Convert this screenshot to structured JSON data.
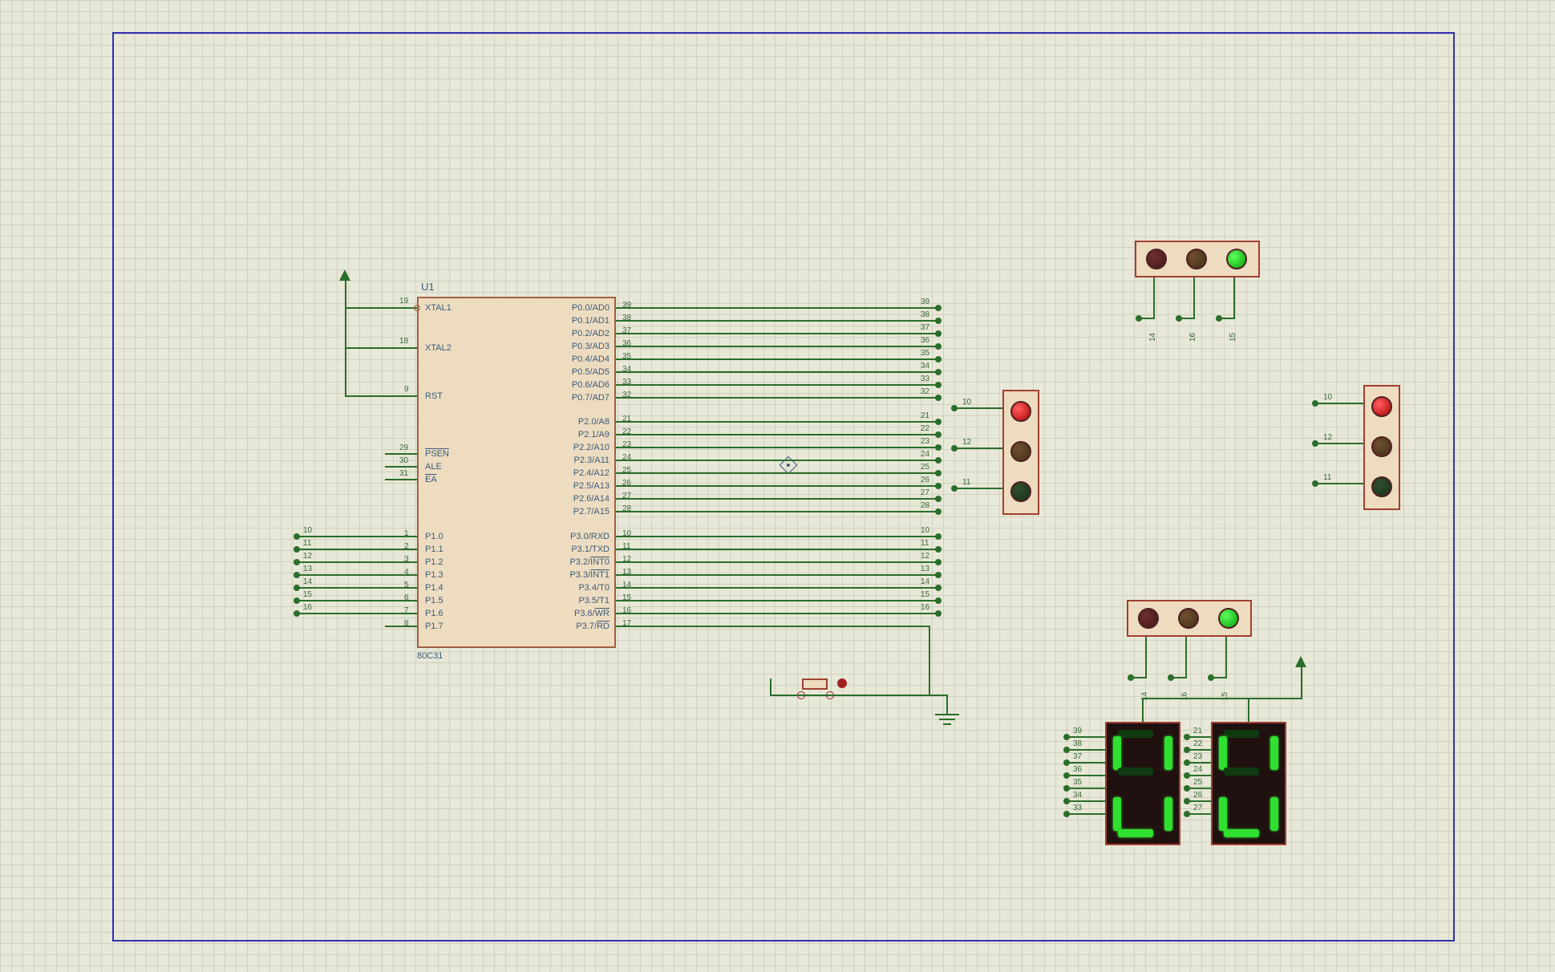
{
  "component": {
    "refdes": "U1",
    "part": "80C31",
    "left_pins": [
      {
        "num": "19",
        "name": "XTAL1"
      },
      {
        "num": "18",
        "name": "XTAL2"
      },
      {
        "num": "9",
        "name": "RST"
      },
      {
        "num": "29",
        "name": "PSEN",
        "over": true
      },
      {
        "num": "30",
        "name": "ALE"
      },
      {
        "num": "31",
        "name": "EA",
        "over": true
      },
      {
        "num": "1",
        "name": "P1.0"
      },
      {
        "num": "2",
        "name": "P1.1"
      },
      {
        "num": "3",
        "name": "P1.2"
      },
      {
        "num": "4",
        "name": "P1.3"
      },
      {
        "num": "5",
        "name": "P1.4"
      },
      {
        "num": "6",
        "name": "P1.5"
      },
      {
        "num": "7",
        "name": "P1.6"
      },
      {
        "num": "8",
        "name": "P1.7"
      }
    ],
    "right_pins": [
      {
        "num": "39",
        "name": "P0.0/AD0"
      },
      {
        "num": "38",
        "name": "P0.1/AD1"
      },
      {
        "num": "37",
        "name": "P0.2/AD2"
      },
      {
        "num": "36",
        "name": "P0.3/AD3"
      },
      {
        "num": "35",
        "name": "P0.4/AD4"
      },
      {
        "num": "34",
        "name": "P0.5/AD5"
      },
      {
        "num": "33",
        "name": "P0.6/AD6"
      },
      {
        "num": "32",
        "name": "P0.7/AD7"
      },
      {
        "num": "21",
        "name": "P2.0/A8"
      },
      {
        "num": "22",
        "name": "P2.1/A9"
      },
      {
        "num": "23",
        "name": "P2.2/A10"
      },
      {
        "num": "24",
        "name": "P2.3/A11"
      },
      {
        "num": "25",
        "name": "P2.4/A12"
      },
      {
        "num": "26",
        "name": "P2.5/A13"
      },
      {
        "num": "27",
        "name": "P2.6/A14"
      },
      {
        "num": "28",
        "name": "P2.7/A15"
      },
      {
        "num": "10",
        "name": "P3.0/RXD"
      },
      {
        "num": "11",
        "name": "P3.1/TXD"
      },
      {
        "num": "12",
        "name": "P3.2/INT0",
        "over_part": "INT0"
      },
      {
        "num": "13",
        "name": "P3.3/INT1",
        "over_part": "INT1"
      },
      {
        "num": "14",
        "name": "P3.4/T0"
      },
      {
        "num": "15",
        "name": "P3.5/T1"
      },
      {
        "num": "16",
        "name": "P3.6/WR",
        "over_part": "WR"
      },
      {
        "num": "17",
        "name": "P3.7/RD",
        "over_part": "RD"
      }
    ]
  },
  "bus_p0_labels": [
    "39",
    "38",
    "37",
    "36",
    "35",
    "34",
    "33",
    "32"
  ],
  "bus_p2_labels": [
    "21",
    "22",
    "23",
    "24",
    "25",
    "26",
    "27",
    "28"
  ],
  "p1_nets": [
    "10",
    "11",
    "12",
    "13",
    "14",
    "15",
    "16"
  ],
  "p3_nets": [
    "10",
    "11",
    "12",
    "13",
    "14",
    "15",
    "16"
  ],
  "tl_top": {
    "nets": [
      "14",
      "16",
      "15"
    ],
    "states": [
      "red-off",
      "yel-off",
      "grn-on"
    ]
  },
  "tl_left": {
    "nets": [
      "10",
      "12",
      "11"
    ],
    "states": [
      "red-on",
      "yel-off",
      "grn-off"
    ]
  },
  "tl_right": {
    "nets": [
      "10",
      "12",
      "11"
    ],
    "states": [
      "red-on",
      "yel-off",
      "grn-off"
    ]
  },
  "tl_bottom": {
    "nets": [
      "14",
      "16",
      "15"
    ],
    "states": [
      "red-off",
      "yel-off",
      "grn-on"
    ]
  },
  "seg_left": {
    "nets": [
      "39",
      "38",
      "37",
      "36",
      "35",
      "34",
      "33"
    ],
    "on": {
      "A": false,
      "B": true,
      "C": true,
      "D": true,
      "E": true,
      "F": true,
      "G": false
    }
  },
  "seg_right": {
    "nets": [
      "21",
      "22",
      "23",
      "24",
      "25",
      "26",
      "27"
    ],
    "on": {
      "A": false,
      "B": true,
      "C": true,
      "D": true,
      "E": true,
      "F": true,
      "G": false
    }
  }
}
